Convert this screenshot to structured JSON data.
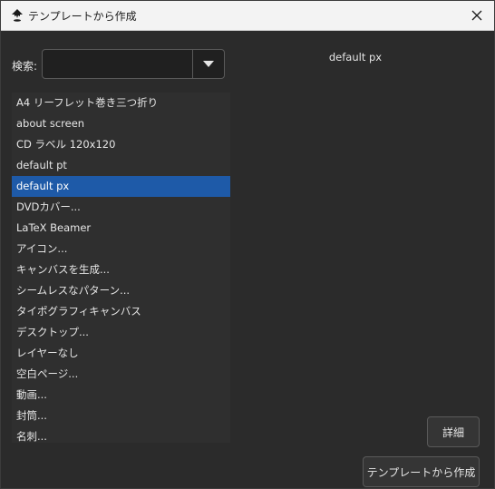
{
  "window": {
    "title": "テンプレートから作成"
  },
  "search": {
    "label": "検索:",
    "value": "",
    "placeholder": ""
  },
  "templates": {
    "items": [
      "A4 リーフレット巻き三つ折り",
      "about screen",
      "CD ラベル 120x120",
      "default pt",
      "default px",
      "DVDカバー...",
      "LaTeX Beamer",
      "アイコン...",
      "キャンバスを生成...",
      "シームレスなパターン...",
      "タイポグラフィキャンバス",
      "デスクトップ...",
      "レイヤーなし",
      "空白ページ...",
      "動画...",
      "封筒...",
      "名刺..."
    ],
    "selected_index": 4
  },
  "preview": {
    "title": "default px"
  },
  "buttons": {
    "details": "詳細",
    "create": "テンプレートから作成"
  },
  "icons": {
    "app": "inkscape-icon",
    "close": "close-icon",
    "dropdown": "triangle-down-icon"
  }
}
